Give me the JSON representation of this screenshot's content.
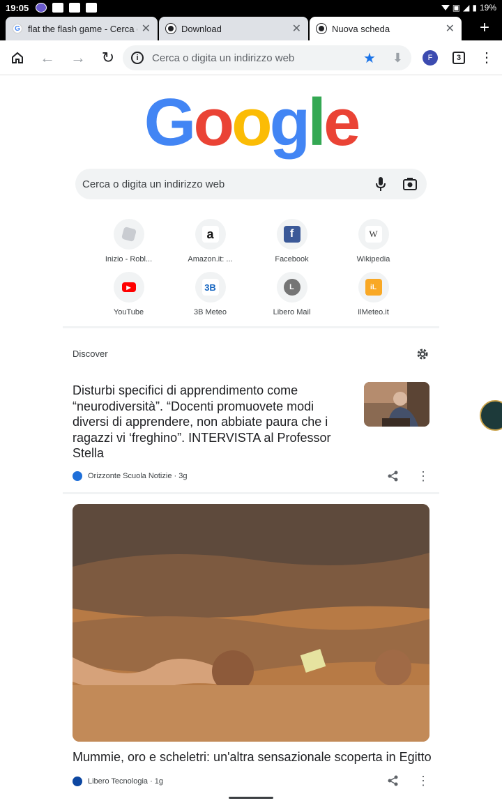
{
  "status_bar": {
    "time": "19:05",
    "battery": "19%"
  },
  "tabs": [
    {
      "label": "flat the flash game - Cerca co",
      "favicon": "google-g-icon"
    },
    {
      "label": "Download",
      "favicon": "chrome-icon"
    },
    {
      "label": "Nuova scheda",
      "favicon": "chrome-icon",
      "active": true
    }
  ],
  "toolbar": {
    "omnibox_placeholder": "Cerca o digita un indirizzo web",
    "avatar_letter": "F",
    "tab_count": "3",
    "star_color": "#1a73e8"
  },
  "google_logo": [
    "G",
    "o",
    "o",
    "g",
    "l",
    "e"
  ],
  "search": {
    "placeholder": "Cerca o digita un indirizzo web"
  },
  "shortcuts": [
    {
      "label": "Inizio - Robl...",
      "icon": "roblox-icon"
    },
    {
      "label": "Amazon.it: ...",
      "icon": "amazon-icon"
    },
    {
      "label": "Facebook",
      "icon": "facebook-icon"
    },
    {
      "label": "Wikipedia",
      "icon": "wikipedia-icon"
    },
    {
      "label": "YouTube",
      "icon": "youtube-icon"
    },
    {
      "label": "3B Meteo",
      "icon": "3b-meteo-icon"
    },
    {
      "label": "Libero Mail",
      "icon": "libero-mail-icon",
      "letter": "L"
    },
    {
      "label": "IlMeteo.it",
      "icon": "ilmeteo-icon"
    }
  ],
  "discover": {
    "title": "Discover",
    "cards": [
      {
        "title": "Disturbi specifici di apprendimento come “neurodiversità”. “Docenti promuovete modi diversi di apprendere, non abbiate paura che i ragazzi vi ‘freghino”. INTERVISTA al Professor Stella",
        "source": "Orizzonte Scuola Notizie · 3g"
      },
      {
        "title": "Mummie, oro e scheletri: un'altra sensazionale scoperta in Egitto",
        "source": "Libero Tecnologia · 1g"
      }
    ]
  }
}
